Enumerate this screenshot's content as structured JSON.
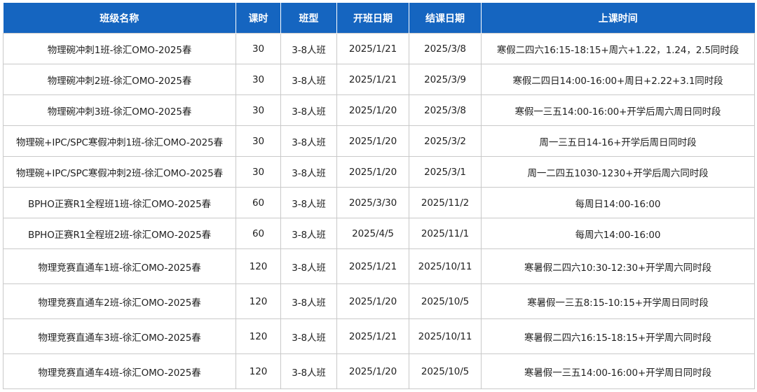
{
  "table": {
    "headers": [
      "班级名称",
      "课时",
      "班型",
      "开班日期",
      "结课日期",
      "上课时间"
    ],
    "rows": [
      [
        "物理碗冲刺1班-徐汇OMO-2025春",
        "30",
        "3-8人班",
        "2025/1/21",
        "2025/3/8",
        "寒假二四六16:15-18:15+周六+1.22，1.24，2.5同时段"
      ],
      [
        "物理碗冲刺2班-徐汇OMO-2025春",
        "30",
        "3-8人班",
        "2025/1/21",
        "2025/3/9",
        "寒假二四日14:00-16:00+周日+2.22+3.1同时段"
      ],
      [
        "物理碗冲刺3班-徐汇OMO-2025春",
        "30",
        "3-8人班",
        "2025/1/20",
        "2025/3/8",
        "寒假一三五14:00-16:00+开学后周六周日同时段"
      ],
      [
        "物理碗+IPC/SPC寒假冲刺1班-徐汇OMO-2025春",
        "30",
        "3-8人班",
        "2025/1/20",
        "2025/3/2",
        "周一三五日14-16+开学后周日同时段"
      ],
      [
        "物理碗+IPC/SPC寒假冲刺2班-徐汇OMO-2025春",
        "30",
        "3-8人班",
        "2025/1/20",
        "2025/3/1",
        "周一二四五1030-1230+开学后周六同时段"
      ],
      [
        "BPHO正赛R1全程班1班-徐汇OMO-2025春",
        "60",
        "3-8人班",
        "2025/3/30",
        "2025/11/2",
        "每周日14:00-16:00"
      ],
      [
        "BPHO正赛R1全程班2班-徐汇OMO-2025春",
        "60",
        "3-8人班",
        "2025/4/5",
        "2025/11/1",
        "每周六14:00-16:00"
      ],
      [
        "物理竞赛直通车1班-徐汇OMO-2025春",
        "120",
        "3-8人班",
        "2025/1/21",
        "2025/10/11",
        "寒暑假二四六10:30-12:30+开学周六同时段"
      ],
      [
        "物理竞赛直通车2班-徐汇OMO-2025春",
        "120",
        "3-8人班",
        "2025/1/20",
        "2025/10/5",
        "寒暑假一三五8:15-10:15+开学周日同时段"
      ],
      [
        "物理竞赛直通车3班-徐汇OMO-2025春",
        "120",
        "3-8人班",
        "2025/1/21",
        "2025/10/11",
        "寒暑假二四六16:15-18:15+开学周六同时段"
      ],
      [
        "物理竞赛直通车4班-徐汇OMO-2025春",
        "120",
        "3-8人班",
        "2025/1/20",
        "2025/10/5",
        "寒暑假一三五14:00-16:00+开学周日同时段"
      ]
    ]
  },
  "colors": {
    "header_bg": "#1565c0",
    "header_text": "#ffffff",
    "border": "#c9c9c9"
  }
}
